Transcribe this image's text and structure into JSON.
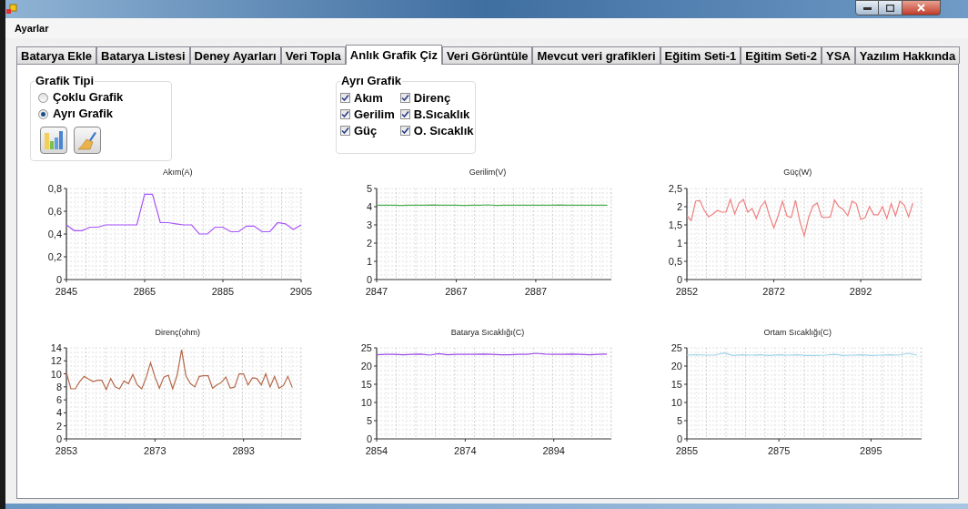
{
  "menu": [
    "Ayarlar"
  ],
  "tabs": [
    {
      "label": "Batarya Ekle",
      "selected": false
    },
    {
      "label": "Batarya Listesi",
      "selected": false
    },
    {
      "label": "Deney Ayarları",
      "selected": false
    },
    {
      "label": "Veri Topla",
      "selected": false
    },
    {
      "label": "Anlık Grafik Çiz",
      "selected": true
    },
    {
      "label": "Veri Görüntüle",
      "selected": false
    },
    {
      "label": "Mevcut veri grafikleri",
      "selected": false
    },
    {
      "label": "Eğitim Seti-1",
      "selected": false
    },
    {
      "label": "Eğitim Seti-2",
      "selected": false
    },
    {
      "label": "YSA",
      "selected": false
    },
    {
      "label": "Yazılım Hakkında",
      "selected": false
    }
  ],
  "chart_type_group": {
    "title": "Grafik Tipi",
    "options": [
      {
        "label": "Çoklu Grafik",
        "selected": false
      },
      {
        "label": "Ayrı Grafik",
        "selected": true
      }
    ]
  },
  "separate_group": {
    "title": "Ayrı Grafik",
    "columns": [
      [
        {
          "label": "Akım",
          "checked": true
        },
        {
          "label": "Gerilim",
          "checked": true
        },
        {
          "label": "Güç",
          "checked": true
        }
      ],
      [
        {
          "label": "Direnç",
          "checked": true
        },
        {
          "label": "B.Sıcaklık",
          "checked": true
        },
        {
          "label": "O. Sıcaklık",
          "checked": true
        }
      ]
    ]
  },
  "charts": [
    {
      "chart_data": {
        "type": "line",
        "title": "Akım(A)",
        "grid": true,
        "xlim": [
          2845,
          2905
        ],
        "ylim": [
          0,
          0.8
        ],
        "xticks": [
          2845,
          2865,
          2885,
          2905
        ],
        "yticks": [
          0,
          {
            "value": 0.2,
            "label": "0,2"
          },
          {
            "value": 0.4,
            "label": "0,4"
          },
          {
            "value": 0.6,
            "label": "0,6"
          },
          {
            "value": 0.8,
            "label": "0,8"
          }
        ],
        "x": [
          2845,
          2847,
          2849,
          2851,
          2853,
          2855,
          2857,
          2859,
          2861,
          2863,
          2865,
          2867,
          2869,
          2871,
          2873,
          2875,
          2877,
          2879,
          2881,
          2883,
          2885,
          2887,
          2889,
          2891,
          2893,
          2895,
          2897,
          2899,
          2901,
          2903,
          2905
        ],
        "series": [
          {
            "color": "#a855f7",
            "values": [
              0.48,
              0.43,
              0.43,
              0.46,
              0.46,
              0.48,
              0.48,
              0.48,
              0.48,
              0.48,
              0.75,
              0.75,
              0.5,
              0.5,
              0.49,
              0.48,
              0.48,
              0.4,
              0.4,
              0.46,
              0.46,
              0.42,
              0.42,
              0.47,
              0.47,
              0.42,
              0.42,
              0.5,
              0.49,
              0.44,
              0.48
            ]
          }
        ]
      }
    },
    {
      "chart_data": {
        "type": "line",
        "title": "Gerilim(V)",
        "grid": true,
        "xlim": [
          2847,
          2906
        ],
        "ylim": [
          0,
          5
        ],
        "xticks": [
          2847,
          2867,
          2887
        ],
        "yticks": [
          0,
          1,
          2,
          3,
          4,
          5
        ],
        "x": [
          2847,
          2849,
          2851,
          2853,
          2855,
          2857,
          2859,
          2861,
          2863,
          2865,
          2867,
          2869,
          2871,
          2873,
          2875,
          2877,
          2879,
          2881,
          2883,
          2885,
          2887,
          2889,
          2891,
          2893,
          2895,
          2897,
          2899,
          2901,
          2903,
          2905
        ],
        "series": [
          {
            "color": "#4caf50",
            "values": [
              4.08,
              4.08,
              4.08,
              4.07,
              4.08,
              4.08,
              4.08,
              4.09,
              4.08,
              4.08,
              4.08,
              4.07,
              4.08,
              4.08,
              4.1,
              4.07,
              4.08,
              4.08,
              4.08,
              4.08,
              4.08,
              4.08,
              4.08,
              4.09,
              4.08,
              4.08,
              4.08,
              4.08,
              4.08,
              4.08
            ]
          }
        ]
      }
    },
    {
      "chart_data": {
        "type": "line",
        "title": "Güç(W)",
        "grid": true,
        "xlim": [
          2852,
          2906
        ],
        "ylim": [
          0,
          2.5
        ],
        "xticks": [
          2852,
          2872,
          2892
        ],
        "yticks": [
          0,
          {
            "value": 0.5,
            "label": "0,5"
          },
          1,
          {
            "value": 1.5,
            "label": "1,5"
          },
          2,
          {
            "value": 2.5,
            "label": "2,5"
          }
        ],
        "x": [
          2852,
          2853,
          2854,
          2855,
          2856,
          2857,
          2858,
          2859,
          2860,
          2861,
          2862,
          2863,
          2864,
          2865,
          2866,
          2867,
          2868,
          2869,
          2870,
          2871,
          2872,
          2873,
          2874,
          2875,
          2876,
          2877,
          2878,
          2879,
          2880,
          2881,
          2882,
          2883,
          2884,
          2885,
          2886,
          2887,
          2888,
          2889,
          2890,
          2891,
          2892,
          2893,
          2894,
          2895,
          2896,
          2897,
          2898,
          2899,
          2900,
          2901,
          2902,
          2903,
          2904
        ],
        "series": [
          {
            "color": "#f08080",
            "values": [
              1.75,
              1.62,
              2.15,
              2.17,
              1.9,
              1.72,
              1.8,
              1.9,
              1.85,
              1.85,
              2.2,
              1.8,
              2.1,
              2.2,
              1.85,
              1.95,
              1.68,
              2.0,
              2.15,
              1.75,
              1.42,
              1.75,
              2.15,
              1.75,
              1.7,
              2.17,
              1.6,
              1.2,
              1.7,
              2.02,
              2.1,
              1.72,
              1.7,
              1.72,
              2.18,
              2.0,
              1.92,
              1.75,
              2.15,
              2.08,
              1.65,
              1.7,
              2.0,
              1.78,
              1.78,
              2.0,
              1.68,
              2.08,
              1.75,
              2.15,
              2.05,
              1.72,
              2.1
            ]
          }
        ]
      }
    },
    {
      "chart_data": {
        "type": "line",
        "title": "Direnç(ohm)",
        "grid": true,
        "xlim": [
          2853,
          2906
        ],
        "ylim": [
          0,
          14
        ],
        "xticks": [
          2853,
          2873,
          2893
        ],
        "yticks": [
          0,
          2,
          4,
          6,
          8,
          10,
          12,
          14
        ],
        "x": [
          2853,
          2854,
          2855,
          2856,
          2857,
          2858,
          2859,
          2860,
          2861,
          2862,
          2863,
          2864,
          2865,
          2866,
          2867,
          2868,
          2869,
          2870,
          2871,
          2872,
          2873,
          2874,
          2875,
          2876,
          2877,
          2878,
          2879,
          2880,
          2881,
          2882,
          2883,
          2884,
          2885,
          2886,
          2887,
          2888,
          2889,
          2890,
          2891,
          2892,
          2893,
          2894,
          2895,
          2896,
          2897,
          2898,
          2899,
          2900,
          2901,
          2902,
          2903,
          2904
        ],
        "series": [
          {
            "color": "#b5694a",
            "values": [
              10.2,
              7.7,
              7.7,
              8.8,
              9.6,
              9.2,
              8.8,
              9.0,
              9.0,
              7.6,
              9.3,
              8.0,
              7.7,
              8.9,
              8.5,
              9.9,
              8.3,
              7.7,
              9.4,
              11.7,
              9.5,
              7.8,
              9.5,
              9.8,
              7.7,
              9.8,
              13.7,
              9.7,
              8.5,
              8.0,
              9.6,
              9.7,
              9.7,
              7.8,
              8.3,
              8.7,
              9.5,
              7.8,
              8.0,
              10.0,
              10.0,
              8.3,
              9.4,
              9.3,
              8.3,
              10.0,
              8.0,
              9.6,
              7.8,
              8.2,
              9.6,
              7.9
            ]
          }
        ]
      }
    },
    {
      "chart_data": {
        "type": "line",
        "title": "Batarya Sıcaklığı(C)",
        "grid": true,
        "xlim": [
          2854,
          2907
        ],
        "ylim": [
          0,
          25
        ],
        "xticks": [
          2854,
          2874,
          2894
        ],
        "yticks": [
          0,
          5,
          10,
          15,
          20,
          25
        ],
        "x": [
          2854,
          2856,
          2858,
          2860,
          2862,
          2864,
          2866,
          2868,
          2870,
          2872,
          2874,
          2876,
          2878,
          2880,
          2882,
          2884,
          2886,
          2888,
          2890,
          2892,
          2894,
          2896,
          2898,
          2900,
          2902,
          2904,
          2906
        ],
        "series": [
          {
            "color": "#9b4de6",
            "values": [
              23.1,
              23.2,
              23.2,
              23.1,
              23.2,
              23.3,
              23.0,
              23.4,
              23.1,
              23.2,
              23.2,
              23.2,
              23.3,
              23.2,
              23.1,
              23.1,
              23.2,
              23.2,
              23.5,
              23.3,
              23.2,
              23.2,
              23.3,
              23.2,
              23.1,
              23.2,
              23.3
            ]
          }
        ]
      }
    },
    {
      "chart_data": {
        "type": "line",
        "title": "Ortam Sıcaklığı(C)",
        "grid": true,
        "xlim": [
          2855,
          2906
        ],
        "ylim": [
          0,
          25
        ],
        "xticks": [
          2855,
          2875,
          2895
        ],
        "yticks": [
          0,
          5,
          10,
          15,
          20,
          25
        ],
        "x": [
          2855,
          2857,
          2859,
          2861,
          2863,
          2865,
          2867,
          2869,
          2871,
          2873,
          2875,
          2877,
          2879,
          2881,
          2883,
          2885,
          2887,
          2889,
          2891,
          2893,
          2895,
          2897,
          2899,
          2901,
          2903,
          2905
        ],
        "series": [
          {
            "color": "#9fd4ea",
            "values": [
              23.0,
              23.1,
              23.0,
              23.0,
              23.6,
              22.9,
              23.1,
              23.0,
              23.1,
              22.9,
              23.1,
              23.0,
              23.1,
              22.9,
              22.9,
              23.0,
              23.2,
              22.9,
              23.0,
              23.1,
              22.9,
              23.0,
              23.1,
              23.0,
              23.5,
              23.0
            ]
          }
        ]
      }
    }
  ]
}
